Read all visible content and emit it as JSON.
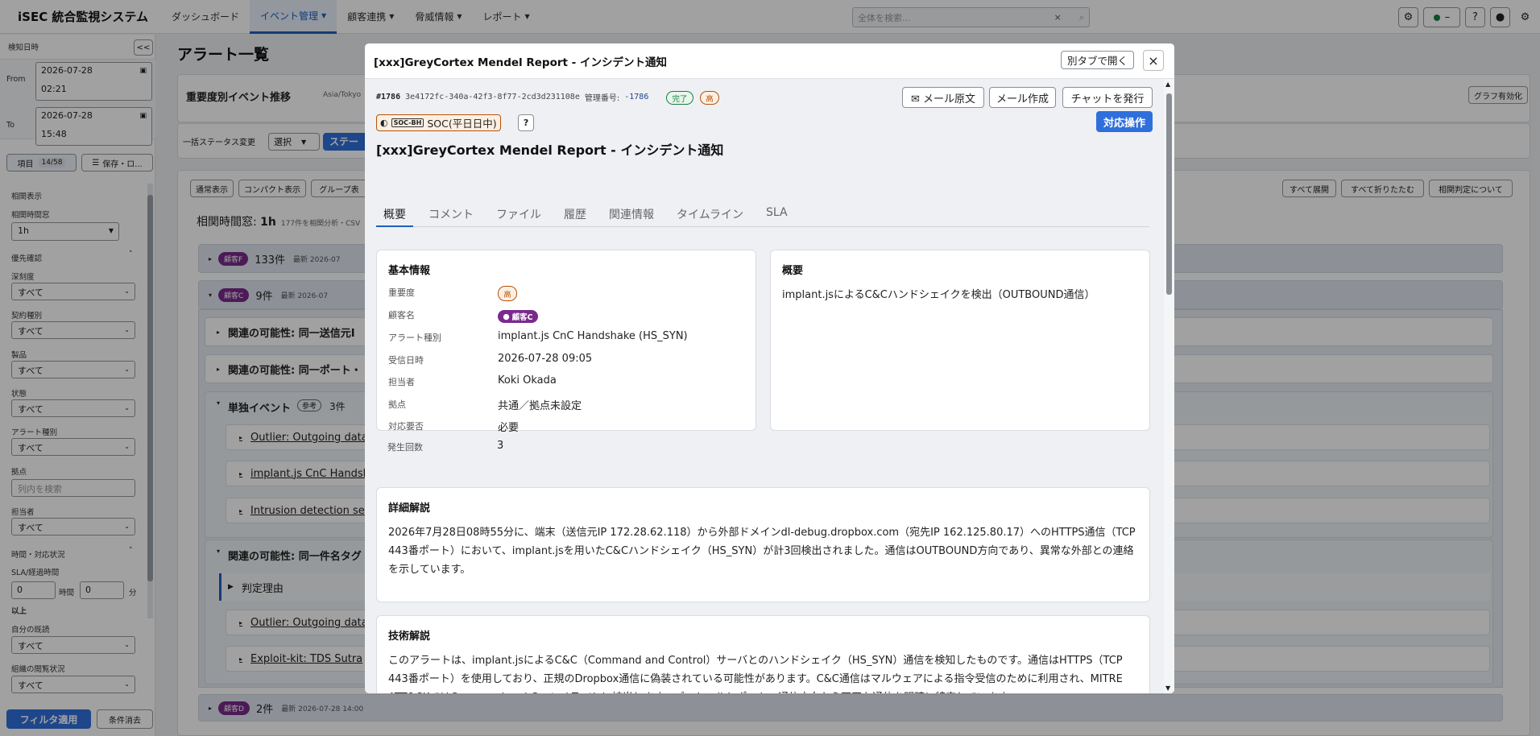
{
  "app": {
    "title": "iSEC 統合監視システム"
  },
  "nav": [
    {
      "label": "ダッシュボード",
      "caret": false
    },
    {
      "label": "イベント管理",
      "caret": true
    },
    {
      "label": "顧客連携",
      "caret": true
    },
    {
      "label": "脅威情報",
      "caret": true
    },
    {
      "label": "レポート",
      "caret": true
    }
  ],
  "search": {
    "placeholder": "全体を検索...",
    "clear": "×",
    "icon": "⌕"
  },
  "header_icons": {
    "status": "–",
    "help": "?",
    "user": "●",
    "settings": "⚙"
  },
  "sidebar": {
    "detect_label": "検知日時",
    "collapse": "<<",
    "from_label": "From",
    "from_date": "2026-07-28",
    "from_time": "02:21",
    "to_label": "To",
    "to_date": "2026-07-28",
    "to_time": "15:48",
    "items_button": "項目",
    "items_count": "14/58",
    "save_button": "保存・ロ...",
    "corr_header": "相関表示",
    "corr_window_label": "相関時間窓",
    "corr_window_value": "1h",
    "priority_header": "優先確認",
    "filters": [
      {
        "label": "深刻度",
        "value": "すべて"
      },
      {
        "label": "契約種別",
        "value": "すべて"
      },
      {
        "label": "製品",
        "value": "すべて"
      },
      {
        "label": "状態",
        "value": "すべて"
      },
      {
        "label": "アラート種別",
        "value": "すべて"
      }
    ],
    "location_label": "拠点",
    "location_placeholder": "列内を検索",
    "assignee_label": "担当者",
    "assignee_value": "すべて",
    "time_header": "時間・対応状況",
    "sla_label": "SLA/経過時間",
    "sla_hours": "0",
    "sla_hours_unit": "時間",
    "sla_minutes": "0",
    "sla_minutes_unit": "分",
    "sla_suffix": "以上",
    "own_read_label": "自分の既読",
    "own_read_value": "すべて",
    "org_read_label": "組織の閲覧状況",
    "org_read_value": "すべて",
    "apply_button": "フィルタ適用",
    "clear_button": "条件消去"
  },
  "main": {
    "title": "アラート一覧",
    "trend_title": "重要度別イベント推移",
    "trend_tz": "Asia/Tokyo",
    "graph_toggle": "グラフ有効化",
    "bulk_label": "一括ステータス変更",
    "bulk_select": "選択",
    "bulk_apply": "ステー",
    "view_normal": "通常表示",
    "view_compact": "コンパクト表示",
    "view_group": "グループ表",
    "expand_all": "すべて展開",
    "collapse_all": "すべて折りたたむ",
    "about_corr": "相関判定について",
    "corr_window_text": "相関時間窓: ",
    "corr_window_bold": "1h",
    "corr_note": "177件を相関分析・CSV",
    "groups": [
      {
        "badge": "顧客F",
        "count": "133件",
        "latest": "最新 2026-07"
      },
      {
        "badge": "顧客C",
        "count": "9件",
        "latest": "最新 2026-07"
      },
      {
        "badge": "顧客D",
        "count": "2件",
        "latest": "最新 2026-07-28 14:00"
      }
    ],
    "sub_rows": [
      {
        "label": "関連の可能性: 同一送信元I"
      },
      {
        "label": "関連の可能性: 同一ポート・"
      },
      {
        "label": "単独イベント",
        "tag": "参考",
        "count": "3件"
      },
      {
        "label": "関連の可能性: 同一件名タグ"
      }
    ],
    "leaves": [
      {
        "label": "Outlier: Outgoing data"
      },
      {
        "label": "implant.js CnC Handsh"
      },
      {
        "label": "Intrusion detection se"
      },
      {
        "label": "Outlier: Outgoing data"
      },
      {
        "label": "Exploit-kit: TDS Sutra"
      }
    ],
    "reason_label": "判定理由"
  },
  "modal": {
    "title": "[xxx]GreyCortex Mendel Report - インシデント通知",
    "open_new_tab": "別タブで開く",
    "close": "×",
    "id": "#1786",
    "uuid": "3e4172fc-340a-42f3-8f77-2cd3d231108e",
    "mgmt_label": "管理番号:",
    "mgmt_value": "-1786",
    "status_badge": "完了",
    "severity_badge": "高",
    "btn_mail_raw": "✉ メール原文",
    "btn_mail_compose": "メール作成",
    "btn_chat": "チャットを発行",
    "btn_respond": "対応操作",
    "soc_tag": "SOC-BH",
    "soc_label": "SOC(平日日中)",
    "help": "?",
    "heading": "[xxx]GreyCortex Mendel Report - インシデント通知",
    "tabs": [
      "概要",
      "コメント",
      "ファイル",
      "履歴",
      "関連情報",
      "タイムライン",
      "SLA"
    ],
    "basic": {
      "title": "基本情報",
      "rows": [
        {
          "k": "重要度",
          "v": "高"
        },
        {
          "k": "顧客名",
          "v": "顧客C"
        },
        {
          "k": "アラート種別",
          "v": "implant.js CnC Handshake (HS_SYN)"
        },
        {
          "k": "受信日時",
          "v": "2026-07-28 09:05"
        },
        {
          "k": "担当者",
          "v": "Koki Okada"
        },
        {
          "k": "拠点",
          "v": "共通／拠点未設定"
        },
        {
          "k": "対応要否",
          "v": "必要"
        },
        {
          "k": "発生回数",
          "v": "3"
        }
      ]
    },
    "summary": {
      "title": "概要",
      "text": "implant.jsによるC&Cハンドシェイクを検出（OUTBOUND通信）"
    },
    "detail": {
      "title": "詳細解説",
      "text": "2026年7月28日08時55分に、端末（送信元IP 172.28.62.118）から外部ドメインdl-debug.dropbox.com（宛先IP 162.125.80.17）へのHTTPS通信（TCP 443番ポート）において、implant.jsを用いたC&Cハンドシェイク（HS_SYN）が計3回検出されました。通信はOUTBOUND方向であり、異常な外部との連絡を示しています。"
    },
    "tech": {
      "title": "技術解説",
      "text": "このアラートは、implant.jsによるC&C（Command and Control）サーバとのハンドシェイク（HS_SYN）通信を検知したものです。通信はHTTPS（TCP 443番ポート）を使用しており、正規のDropbox通信に偽装されている可能性があります。C&C通信はマルウェアによる指令受信のために利用され、MITRE ATT&CKではCommand and Control Tacticに該当します。プロトコルとポート、通信方向から不正な通信を明確に特定しています。"
    }
  },
  "colors": {
    "accent": "#1f5fbf",
    "customer_badge": "#7a2a8c",
    "severity_high": "#b45309",
    "status_done": "#15803d",
    "respond": "#2f6fdc"
  }
}
